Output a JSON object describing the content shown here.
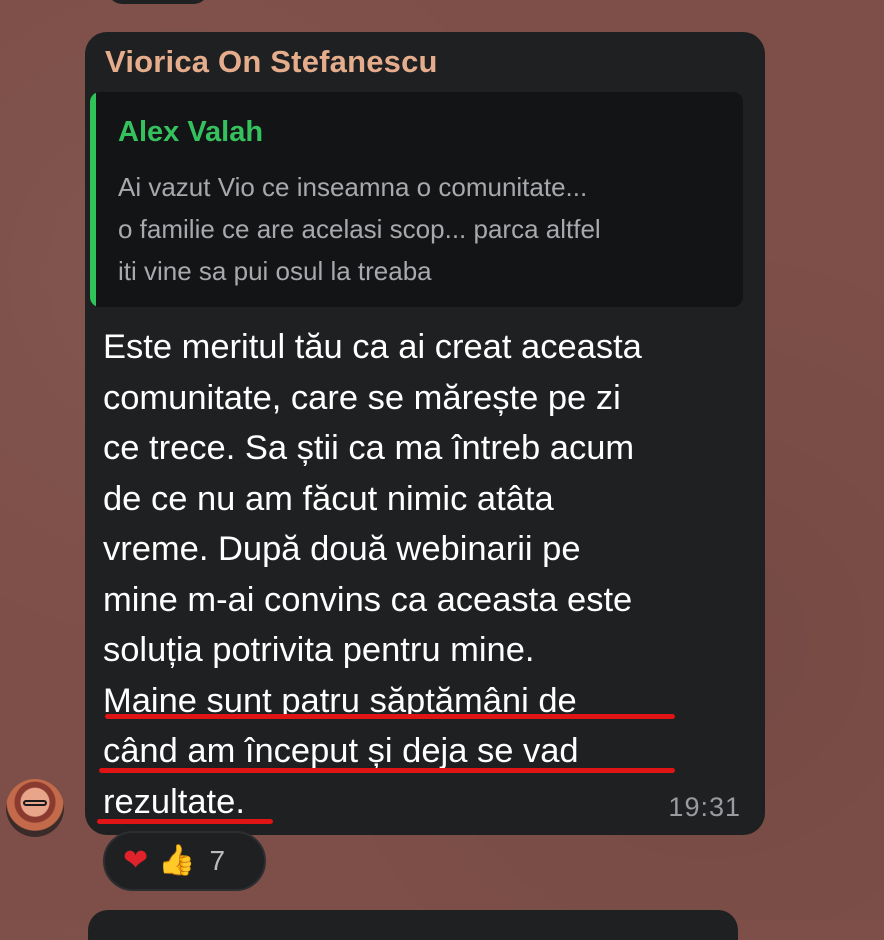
{
  "message": {
    "sender": "Viorica On Stefanescu",
    "quote": {
      "author": "Alex Valah",
      "lines": [
        "Ai vazut Vio ce inseamna o comunitate...",
        "o familie ce are acelasi scop... parca altfel",
        "iti vine sa pui osul la treaba"
      ]
    },
    "lines": [
      "Este meritul tău ca ai creat aceasta",
      "comunitate, care se mărește pe zi",
      "ce trece. Sa știi ca ma întreb acum",
      "de ce nu am făcut nimic atâta",
      "vreme. După două webinarii pe",
      "mine m-ai convins ca aceasta este",
      "soluția potrivita pentru mine.",
      "Maine sunt patru săptămâni de",
      "când am început și deja se vad",
      "rezultate."
    ],
    "time": "19:31"
  },
  "reactions": {
    "heart": "❤",
    "thumbs_up": "👍",
    "count": "7"
  },
  "colors": {
    "background": "#7d4f48",
    "bubble": "#1f2022",
    "sender": "#e5ad8c",
    "quote_accent": "#2fc35a",
    "underline": "#e01414"
  }
}
